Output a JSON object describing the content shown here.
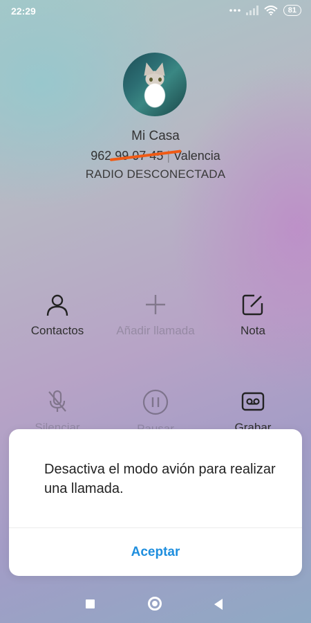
{
  "status_bar": {
    "time": "22:29",
    "battery": "81",
    "icons": [
      "dots-icon",
      "signal-icon",
      "wifi-icon",
      "battery-icon"
    ]
  },
  "contact": {
    "name": "Mi Casa",
    "number": "962 99 07 45",
    "separator": " | ",
    "location": "Valencia",
    "status": "RADIO DESCONECTADA"
  },
  "actions": [
    {
      "label": "Contactos",
      "icon": "person-icon",
      "enabled": true
    },
    {
      "label": "Añadir llamada",
      "icon": "plus-icon",
      "enabled": false
    },
    {
      "label": "Nota",
      "icon": "edit-note-icon",
      "enabled": true
    },
    {
      "label": "Silenciar",
      "icon": "mic-off-icon",
      "enabled": false
    },
    {
      "label": "Pausar",
      "icon": "pause-icon",
      "enabled": false
    },
    {
      "label": "Grabar",
      "icon": "record-icon",
      "enabled": true
    }
  ],
  "dialog": {
    "message": "Desactiva el modo avión para realizar una llamada.",
    "button_label": "Aceptar"
  },
  "colors": {
    "accent": "#1e8ede",
    "redaction": "#f05a14"
  }
}
